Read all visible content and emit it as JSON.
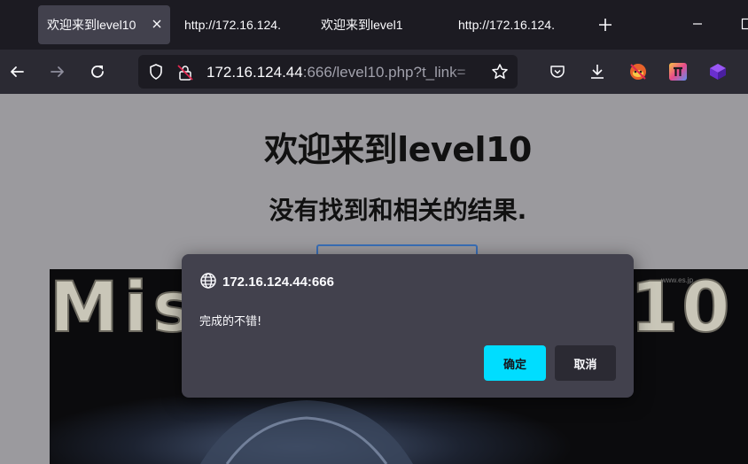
{
  "tabs": [
    {
      "label": "欢迎来到level10",
      "active": true
    },
    {
      "label": "http://172.16.124.",
      "active": false
    },
    {
      "label": "欢迎来到level1",
      "active": false
    },
    {
      "label": "http://172.16.124.",
      "active": false
    }
  ],
  "urlbar": {
    "host": "172.16.124.44",
    "rest": ":666/level10.php?t_link="
  },
  "page": {
    "heading": "欢迎来到level10",
    "subheading": "没有找到和相关的结果.",
    "banner_left": "Mis",
    "banner_right": "10",
    "banner_watermark": "www.es.jp"
  },
  "dialog": {
    "origin": "172.16.124.44:666",
    "message": "完成的不错!",
    "ok_label": "确定",
    "cancel_label": "取消"
  },
  "colors": {
    "accent": "#00ddff",
    "dialog_bg": "#42414d",
    "toolbar_bg": "#2b2a33",
    "tabbar_bg": "#1c1b22"
  },
  "icons": [
    "back-icon",
    "forward-icon",
    "reload-icon",
    "shield-icon",
    "insecure-lock-icon",
    "bookmark-star-icon",
    "pocket-icon",
    "downloads-icon",
    "extension-fox-icon",
    "extension-pi-icon",
    "extension-cube-icon",
    "close-icon",
    "plus-icon",
    "minimize-icon",
    "maximize-icon",
    "globe-icon"
  ]
}
